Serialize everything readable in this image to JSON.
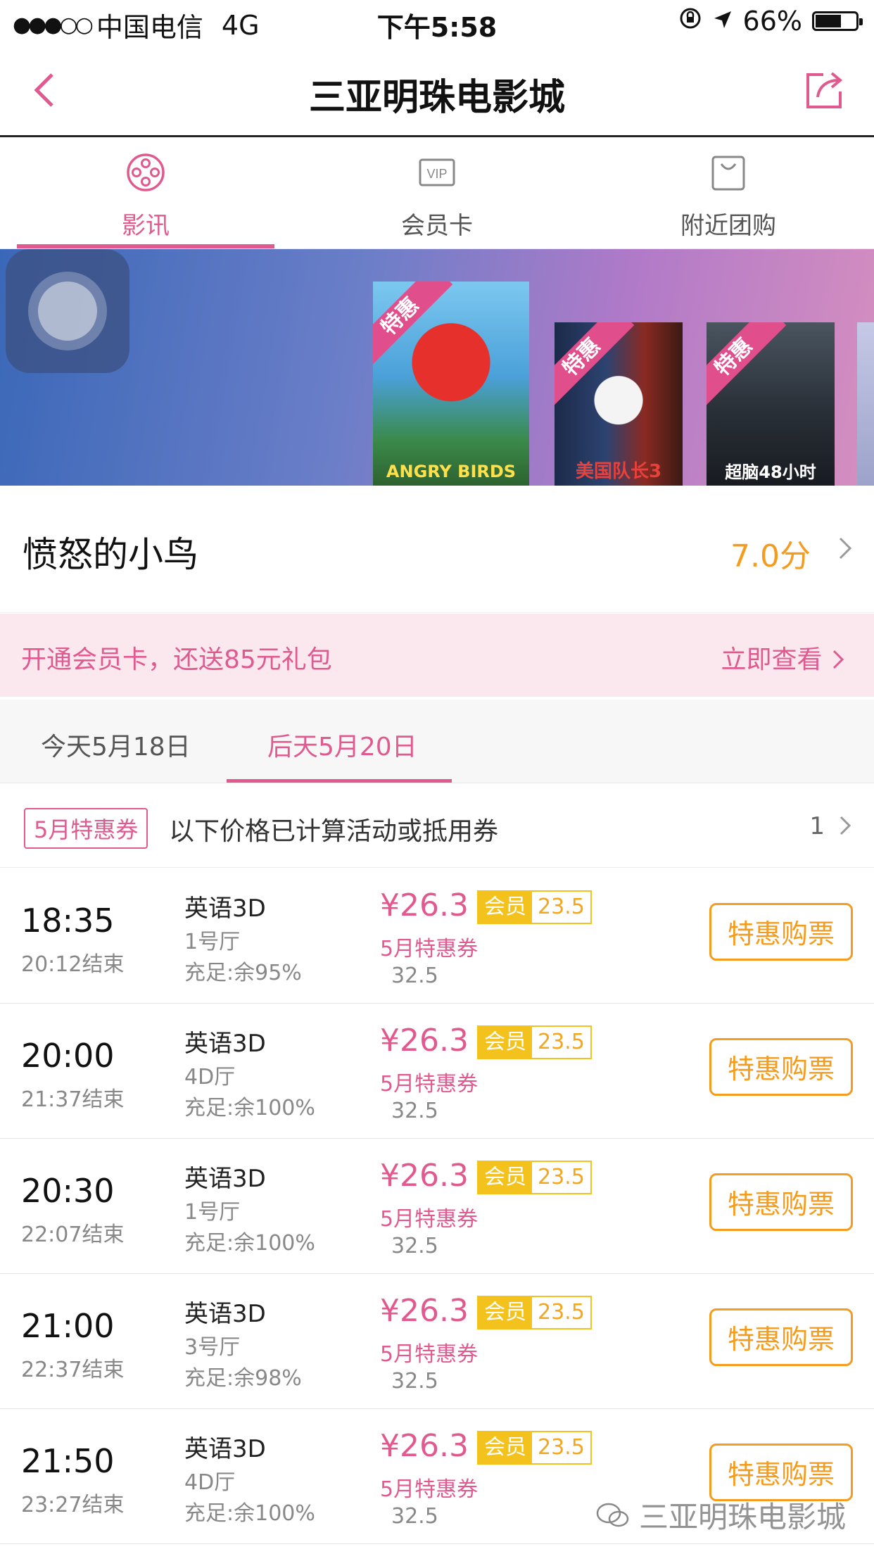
{
  "status": {
    "carrier": "中国电信",
    "network": "4G",
    "time": "下午5:58",
    "battery": "66%",
    "signal_icon": "signal-dots",
    "battery_level": 0.66
  },
  "nav": {
    "title": "三亚明珠电影城",
    "back_icon": "chevron-left-icon",
    "share_icon": "share-icon"
  },
  "tabs": [
    {
      "label": "影讯",
      "icon": "film-reel-icon",
      "active": true
    },
    {
      "label": "会员卡",
      "icon": "vip-card-icon",
      "active": false
    },
    {
      "label": "附近团购",
      "icon": "shopping-bag-icon",
      "active": false
    }
  ],
  "banner": {
    "posters": [
      {
        "ribbon": "特惠",
        "title": "ANGRY BIRDS"
      },
      {
        "ribbon": "特惠",
        "title": "美国队长3"
      },
      {
        "ribbon": "特惠",
        "title": "超脑48小时"
      }
    ]
  },
  "movie": {
    "name": "愤怒的小鸟",
    "score": "7.0分"
  },
  "promo": {
    "text": "开通会员卡，还送85元礼包",
    "link": "立即查看"
  },
  "dates": [
    {
      "label": "今天5月18日",
      "active": false
    },
    {
      "label": "后天5月20日",
      "active": true
    }
  ],
  "coupon": {
    "tag": "5月特惠券",
    "info": "以下价格已计算活动或抵用券",
    "count": "1"
  },
  "showtimes": [
    {
      "start": "18:35",
      "end": "20:12结束",
      "lang": "英语3D",
      "hall": "1号厅",
      "seats": "充足:余95%",
      "price": "¥26.3",
      "member_label": "会员",
      "member_price": "23.5",
      "coupon": "5月特惠券",
      "orig": "32.5",
      "buy": "特惠购票"
    },
    {
      "start": "20:00",
      "end": "21:37结束",
      "lang": "英语3D",
      "hall": "4D厅",
      "seats": "充足:余100%",
      "price": "¥26.3",
      "member_label": "会员",
      "member_price": "23.5",
      "coupon": "5月特惠券",
      "orig": "32.5",
      "buy": "特惠购票"
    },
    {
      "start": "20:30",
      "end": "22:07结束",
      "lang": "英语3D",
      "hall": "1号厅",
      "seats": "充足:余100%",
      "price": "¥26.3",
      "member_label": "会员",
      "member_price": "23.5",
      "coupon": "5月特惠券",
      "orig": "32.5",
      "buy": "特惠购票"
    },
    {
      "start": "21:00",
      "end": "22:37结束",
      "lang": "英语3D",
      "hall": "3号厅",
      "seats": "充足:余98%",
      "price": "¥26.3",
      "member_label": "会员",
      "member_price": "23.5",
      "coupon": "5月特惠券",
      "orig": "32.5",
      "buy": "特惠购票"
    },
    {
      "start": "21:50",
      "end": "23:27结束",
      "lang": "英语3D",
      "hall": "4D厅",
      "seats": "充足:余100%",
      "price": "¥26.3",
      "member_label": "会员",
      "member_price": "23.5",
      "coupon": "5月特惠券",
      "orig": "32.5",
      "buy": "特惠购票"
    }
  ],
  "watermark": "三亚明珠电影城",
  "colors": {
    "accent": "#e05a8f",
    "orange": "#f39c1f",
    "member_yellow": "#f4c21c"
  }
}
